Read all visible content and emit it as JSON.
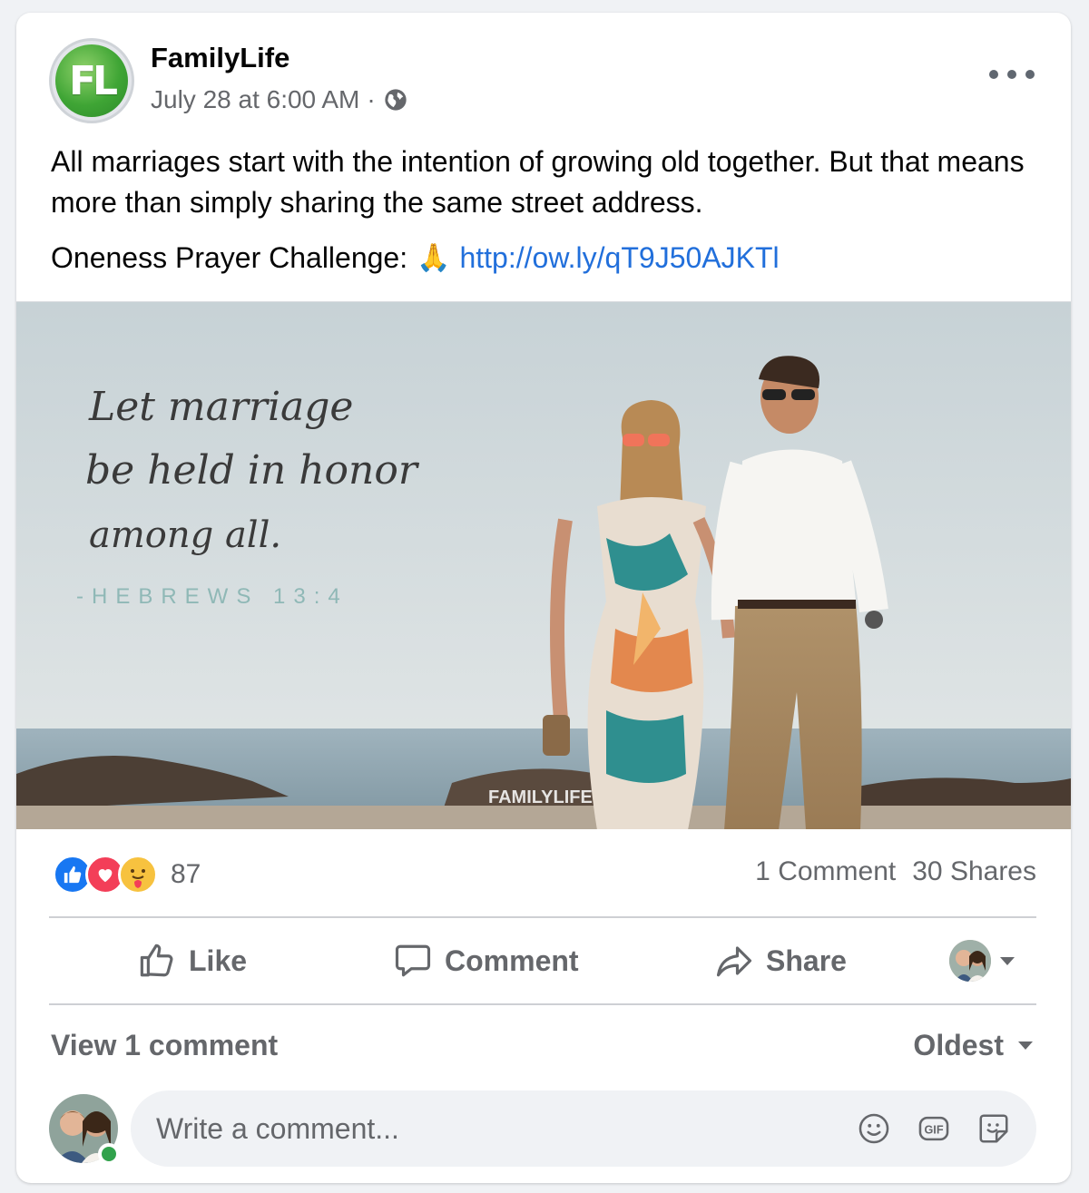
{
  "page": {
    "name": "FamilyLife",
    "avatar_initials": "FL",
    "timestamp": "July 28 at 6:00 AM",
    "separator": "·",
    "privacy_icon": "globe-icon",
    "more_icon": "more-icon"
  },
  "post": {
    "text": "All marriages start with the intention of growing old together. But that means more than simply sharing the same street address.",
    "challenge_label": "Oneness Prayer Challenge:",
    "emoji": "🙏",
    "link": "http://ow.ly/qT9J50AJKTl"
  },
  "image": {
    "quote_line1": "Let marriage",
    "quote_line2": "be held in honor",
    "quote_line3": "among all.",
    "reference": "-HEBREWS 13:4",
    "watermark": "FAMILYLIFE"
  },
  "stats": {
    "reaction_icons": [
      "like-icon",
      "love-icon",
      "care-icon"
    ],
    "reaction_count": "87",
    "comments": "1 Comment",
    "shares": "30 Shares"
  },
  "actions": {
    "like_label": "Like",
    "comment_label": "Comment",
    "share_label": "Share"
  },
  "comments": {
    "view_label": "View 1 comment",
    "sort_label": "Oldest",
    "placeholder": "Write a comment..."
  },
  "colors": {
    "link": "#216fdb",
    "secondary_text": "#65676b",
    "like_blue": "#1877f2",
    "love_red": "#f33e58",
    "online_green": "#31a24c"
  }
}
